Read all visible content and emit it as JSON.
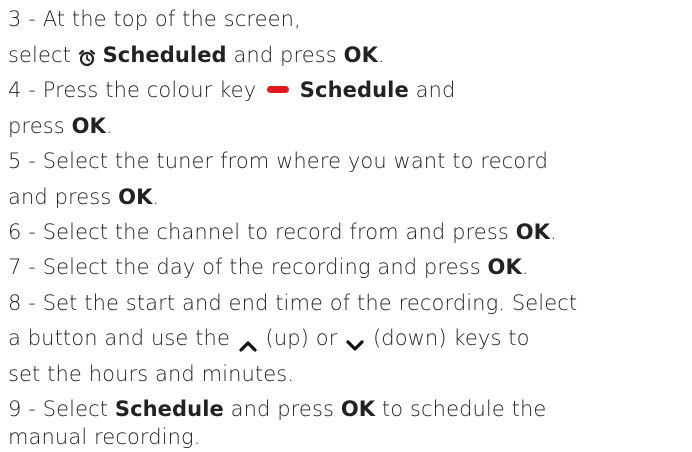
{
  "steps": [
    {
      "line1": "3 -  At the top of the screen,",
      "line2_pre": "select ",
      "line2_bold": "Scheduled",
      "line2_mid": " and press  ",
      "line2_key": "OK",
      "line2_end": ".",
      "icon": "alarm-clock-icon"
    },
    {
      "pre": "4 -  Press the colour key ",
      "key_label": "Schedule",
      "post": " and",
      "line2_pre": "press  ",
      "line2_key": "OK",
      "line2_end": ".",
      "key_color": "#e3191c",
      "icon": "red-colour-key-icon"
    },
    {
      "line1": "5 -  Select the tuner from where you want to record",
      "line2_pre": "and press  ",
      "line2_key": "OK",
      "line2_end": "."
    },
    {
      "pre": "6 -  Select the channel to record from and press  ",
      "key": "OK",
      "end": "."
    },
    {
      "pre": "7 -  Select the day of the recording and press  ",
      "key": "OK",
      "end": "."
    },
    {
      "line1": "8 -  Set the start and end time of the recording. Select",
      "line2_pre": "a button and use the  ",
      "up": " (up) or  ",
      "down": " (down) keys to",
      "line3": "set the hours and minutes.",
      "icons": [
        "chevron-up-icon",
        "chevron-down-icon"
      ]
    },
    {
      "pre": "9 -  Select  ",
      "bold": "Schedule",
      "mid": " and press  ",
      "key": "OK",
      "post": " to schedule the",
      "line2": "manual recording."
    }
  ]
}
